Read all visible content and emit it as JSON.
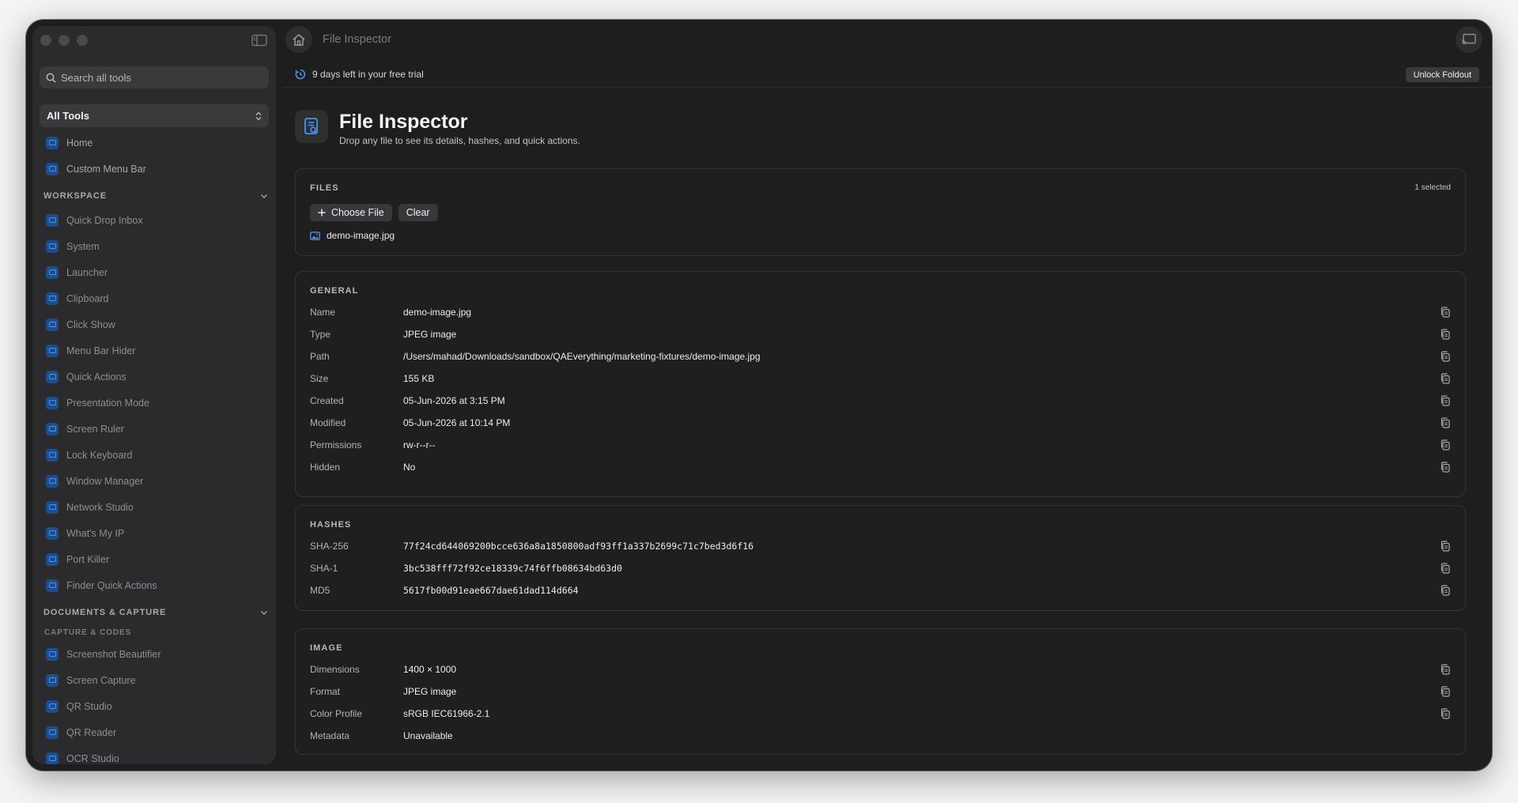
{
  "titlebar": {
    "title": "File Inspector"
  },
  "sidebar": {
    "search_placeholder": "Search all tools",
    "scope": "All Tools",
    "top_items": [
      {
        "label": "Home",
        "icon": "home-icon"
      },
      {
        "label": "Custom Menu Bar",
        "icon": "menu-bar-icon"
      }
    ],
    "workspace": {
      "heading": "WORKSPACE",
      "items": [
        {
          "label": "Quick Drop Inbox",
          "icon": "inbox-icon"
        },
        {
          "label": "System",
          "icon": "system-icon"
        },
        {
          "label": "Launcher",
          "icon": "command-icon"
        },
        {
          "label": "Clipboard",
          "icon": "clipboard-icon"
        },
        {
          "label": "Click Show",
          "icon": "click-icon"
        },
        {
          "label": "Menu Bar Hider",
          "icon": "menu-bar-icon"
        },
        {
          "label": "Quick Actions",
          "icon": "bolt-icon"
        },
        {
          "label": "Presentation Mode",
          "icon": "presentation-icon"
        },
        {
          "label": "Screen Ruler",
          "icon": "ruler-icon"
        },
        {
          "label": "Lock Keyboard",
          "icon": "lock-icon"
        },
        {
          "label": "Window Manager",
          "icon": "window-icon"
        },
        {
          "label": "Network Studio",
          "icon": "network-icon"
        },
        {
          "label": "What's My IP",
          "icon": "globe-icon"
        },
        {
          "label": "Port Killer",
          "icon": "port-icon"
        },
        {
          "label": "Finder Quick Actions",
          "icon": "finder-icon"
        }
      ]
    },
    "documents": {
      "heading": "DOCUMENTS & CAPTURE",
      "subheading": "CAPTURE & CODES",
      "items": [
        {
          "label": "Screenshot Beautifier",
          "icon": "screenshot-icon"
        },
        {
          "label": "Screen Capture",
          "icon": "capture-icon"
        },
        {
          "label": "QR Studio",
          "icon": "qr-icon"
        },
        {
          "label": "QR Reader",
          "icon": "qr-reader-icon"
        },
        {
          "label": "OCR Studio",
          "icon": "ocr-icon"
        }
      ]
    }
  },
  "trial": {
    "text": "9 days left in your free trial",
    "unlock_label": "Unlock Foldout"
  },
  "header": {
    "title": "File Inspector",
    "subtitle": "Drop any file to see its details, hashes, and quick actions."
  },
  "files": {
    "title": "FILES",
    "selected": "1 selected",
    "choose_label": "Choose File",
    "clear_label": "Clear",
    "file_name": "demo-image.jpg"
  },
  "general": {
    "title": "GENERAL",
    "rows": [
      {
        "label": "Name",
        "value": "demo-image.jpg"
      },
      {
        "label": "Type",
        "value": "JPEG image"
      },
      {
        "label": "Path",
        "value": "/Users/mahad/Downloads/sandbox/QAEverything/marketing-fixtures/demo-image.jpg"
      },
      {
        "label": "Size",
        "value": "155 KB"
      },
      {
        "label": "Created",
        "value": "05-Jun-2026 at 3:15 PM"
      },
      {
        "label": "Modified",
        "value": "05-Jun-2026 at 10:14 PM"
      },
      {
        "label": "Permissions",
        "value": "rw-r--r--"
      },
      {
        "label": "Hidden",
        "value": "No"
      }
    ]
  },
  "hashes": {
    "title": "HASHES",
    "rows": [
      {
        "label": "SHA-256",
        "value": "77f24cd644069200bcce636a8a1850800adf93ff1a337b2699c71c7bed3d6f16"
      },
      {
        "label": "SHA-1",
        "value": "3bc538fff72f92ce18339c74f6ffb08634bd63d0"
      },
      {
        "label": "MD5",
        "value": "5617fb00d91eae667dae61dad114d664"
      }
    ]
  },
  "image": {
    "title": "IMAGE",
    "rows": [
      {
        "label": "Dimensions",
        "value": "1400 × 1000",
        "copy": true
      },
      {
        "label": "Format",
        "value": "JPEG image",
        "copy": true
      },
      {
        "label": "Color Profile",
        "value": "sRGB IEC61966-2.1",
        "copy": true
      },
      {
        "label": "Metadata",
        "value": "Unavailable",
        "copy": false
      }
    ]
  },
  "colors": {
    "accent": "#4c93ee",
    "window_bg": "#1e1e1f",
    "sidebar_bg": "#2b2b2d"
  }
}
